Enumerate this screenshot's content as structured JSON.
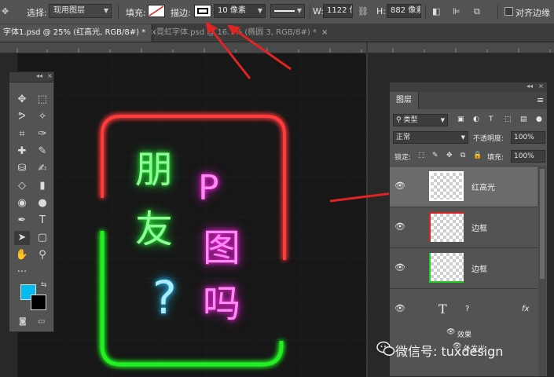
{
  "options_bar": {
    "select_label": "选择:",
    "select_value": "现用图层",
    "fill_label": "填充:",
    "stroke_label": "描边:",
    "stroke_width": "10 像素",
    "w_label": "W:",
    "w_value": "1122 像",
    "h_label": "H:",
    "h_value": "882 像素",
    "align_edges_label": "对齐边缘"
  },
  "tabs": [
    {
      "label": "字体1.psd @ 25% (红高光, RGB/8#) *",
      "close": "×"
    },
    {
      "label": "霓虹字体.psd @ 16.7% (椭圆 3, RGB/8#) *",
      "close": "×"
    }
  ],
  "canvas": {
    "neon_left_top": "朋",
    "neon_left_mid": "友",
    "neon_right_top": "P",
    "neon_right_mid": "图",
    "neon_right_bot": "吗",
    "neon_question": "?",
    "colors": {
      "green": "#5cff6a",
      "magenta": "#ff4df0",
      "cyan": "#4fd8ff",
      "red": "#ff3b3b",
      "frame_green": "#22ee22"
    }
  },
  "toolbox": {
    "collapse": "◂◂",
    "close": "×",
    "more": "···",
    "fg_color": "#00bbf0",
    "bg_color": "#000000",
    "tools": [
      "move-icon",
      "marquee-icon",
      "lasso-icon",
      "magic-wand-icon",
      "crop-icon",
      "eyedropper-icon",
      "healing-icon",
      "brush-icon",
      "stamp-icon",
      "history-brush-icon",
      "eraser-icon",
      "gradient-icon",
      "blur-icon",
      "dodge-icon",
      "pen-icon",
      "type-icon",
      "path-select-icon",
      "shape-icon",
      "hand-icon",
      "zoom-icon"
    ],
    "glyphs": [
      "✥",
      "⬚",
      "ᕗ",
      "✧",
      "⌗",
      "✑",
      "✚",
      "✎",
      "⛁",
      "✍",
      "◇",
      "▮",
      "◉",
      "●",
      "✒",
      "T",
      "➤",
      "▢",
      "✋",
      "⚲"
    ]
  },
  "layers_panel": {
    "collapse": "◂◂",
    "close": "×",
    "tab_label": "图层",
    "menu": "≡",
    "filter_kind": "类型",
    "blend_mode": "正常",
    "opacity_label": "不透明度:",
    "opacity_value": "100%",
    "lock_label": "锁定:",
    "fill_label": "填充:",
    "fill_value": "100%",
    "layers": [
      {
        "name": "红高光",
        "selected": true
      },
      {
        "name": "边框",
        "selected": false
      },
      {
        "name": "边框",
        "selected": false
      },
      {
        "name": "?",
        "selected": false,
        "kind_glyph": "T",
        "fx": "fx"
      }
    ],
    "effects_label": "效果",
    "outer_glow_label": "外发光"
  },
  "watermark": {
    "text": "微信号: tuxdesign"
  }
}
